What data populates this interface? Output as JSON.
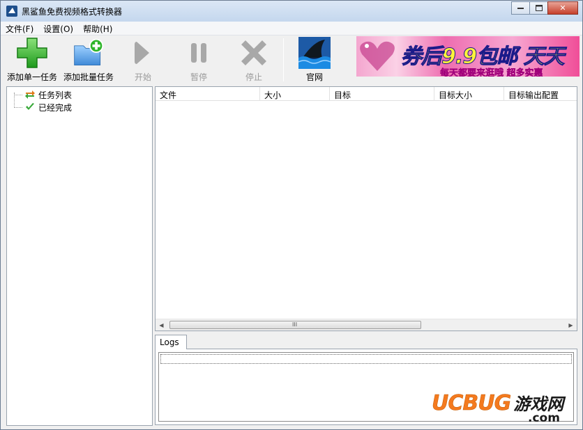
{
  "window": {
    "title": "黑鲨鱼免费视频格式转换器",
    "controls": {
      "minimize": "▭",
      "maximize": "□",
      "close": "✕"
    }
  },
  "menu": [
    "文件(F)",
    "设置(O)",
    "帮助(H)"
  ],
  "toolbar": {
    "add_single": "添加单一任务",
    "add_batch": "添加批量任务",
    "start": "开始",
    "pause": "暂停",
    "stop": "停止",
    "website": "官网"
  },
  "ad": {
    "headline": "券后9.9包邮 天天",
    "subline": "每天都要来逛哦  超多实惠"
  },
  "tree": [
    {
      "label": "任务列表",
      "icon": "swap-arrows-icon"
    },
    {
      "label": "已经完成",
      "icon": "checkmark-icon"
    }
  ],
  "list": {
    "columns": [
      "文件",
      "大小",
      "目标",
      "目标大小",
      "目标输出配置"
    ],
    "rows": [],
    "scroll_grip": "III"
  },
  "logs": {
    "tab_label": "Logs"
  },
  "watermark": {
    "brand": "UCBUG",
    "cn": "游戏网",
    "domain": ".com"
  },
  "colors": {
    "accent_green": "#2fb52a",
    "folder_blue": "#4f9ee8",
    "disabled_gray": "#9a9a9a"
  }
}
